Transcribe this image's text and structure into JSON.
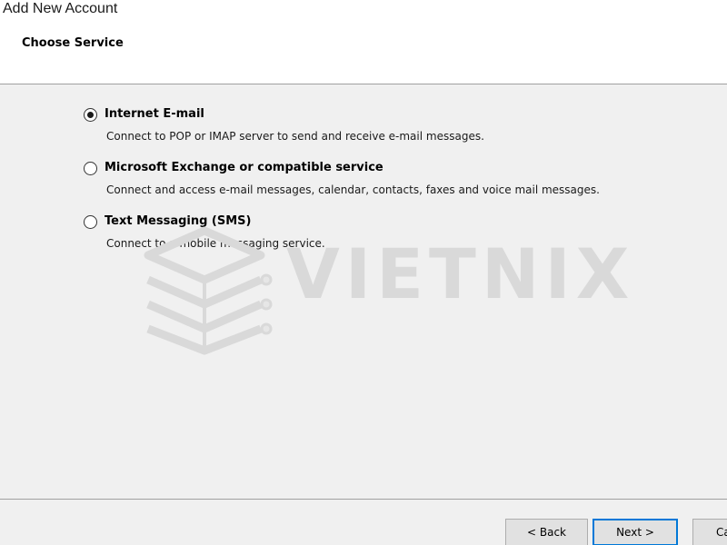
{
  "window": {
    "title": "Add New Account"
  },
  "header": {
    "section_title": "Choose Service"
  },
  "options": [
    {
      "label": "Internet E-mail",
      "description": "Connect to POP or IMAP server to send and receive e-mail messages.",
      "selected": true
    },
    {
      "label": "Microsoft Exchange or compatible service",
      "description": "Connect and access e-mail messages, calendar, contacts, faxes and voice mail messages.",
      "selected": false
    },
    {
      "label": "Text Messaging (SMS)",
      "description": "Connect to a mobile messaging service.",
      "selected": false
    }
  ],
  "watermark": {
    "text": "VIETNIX"
  },
  "footer": {
    "back_label": "< Back",
    "next_label": "Next >",
    "cancel_label": "Ca"
  },
  "colors": {
    "focus_border": "#0078d7",
    "watermark": "#d9d9d9"
  }
}
